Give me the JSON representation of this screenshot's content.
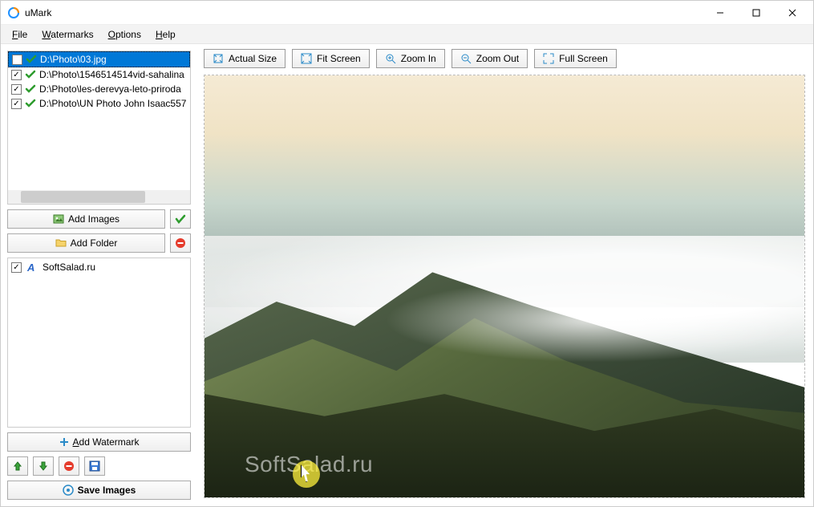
{
  "window": {
    "title": "uMark"
  },
  "menu": {
    "file": "File",
    "watermarks": "Watermarks",
    "options": "Options",
    "help": "Help"
  },
  "files": [
    {
      "path": "D:\\Photo\\03.jpg",
      "selected": true
    },
    {
      "path": "D:\\Photo\\1546514514vid-sahalina",
      "selected": false
    },
    {
      "path": "D:\\Photo\\les-derevya-leto-priroda",
      "selected": false
    },
    {
      "path": "D:\\Photo\\UN Photo John Isaac557",
      "selected": false
    }
  ],
  "sidebar": {
    "add_images": "Add Images",
    "add_folder": "Add Folder",
    "add_watermark": "Add Watermark",
    "save_images": "Save Images"
  },
  "watermarks": [
    {
      "label": "SoftSalad.ru"
    }
  ],
  "toolbar": {
    "actual": "Actual Size",
    "fit": "Fit Screen",
    "zoomin": "Zoom In",
    "zoomout": "Zoom Out",
    "full": "Full Screen"
  },
  "preview": {
    "watermark_text": "SoftSalad.ru"
  }
}
